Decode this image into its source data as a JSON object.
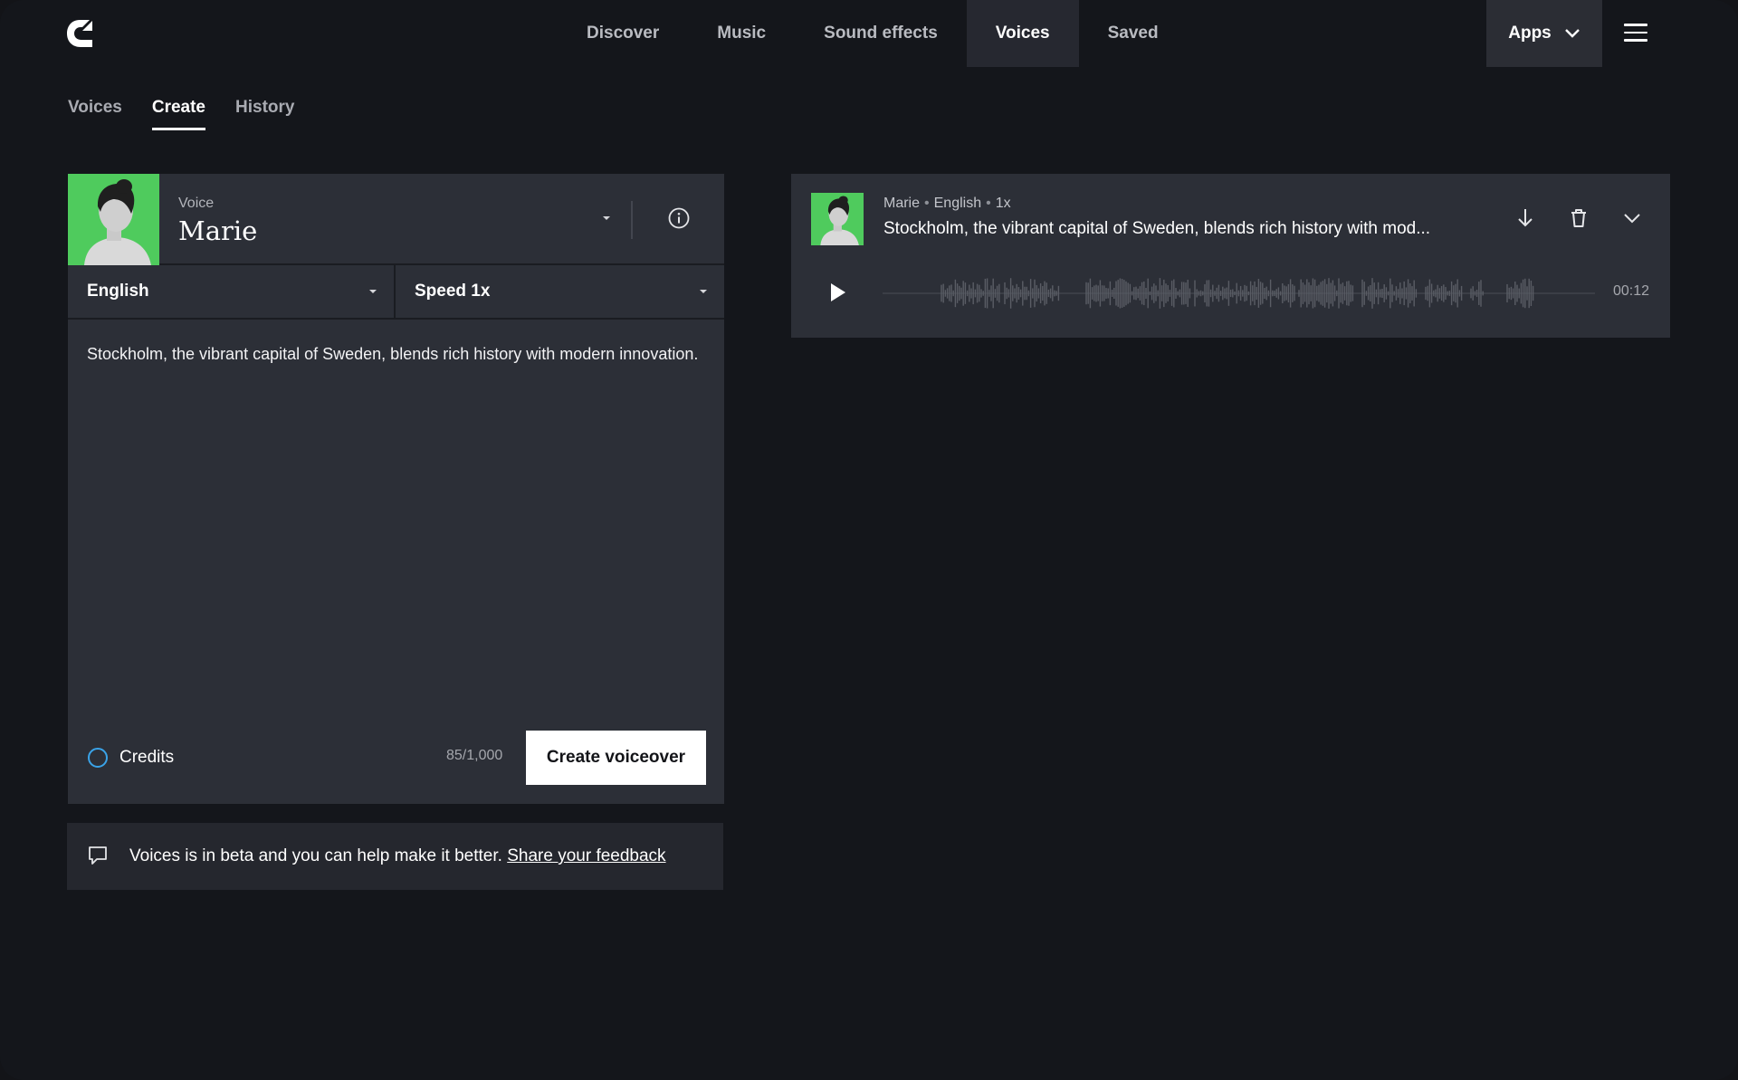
{
  "nav": {
    "links": [
      {
        "label": "Discover"
      },
      {
        "label": "Music"
      },
      {
        "label": "Sound effects"
      },
      {
        "label": "Voices"
      },
      {
        "label": "Saved"
      }
    ],
    "active_index": 3,
    "apps_label": "Apps"
  },
  "subtabs": [
    {
      "label": "Voices"
    },
    {
      "label": "Create"
    },
    {
      "label": "History"
    }
  ],
  "subtabs_active_index": 1,
  "editor": {
    "voice_caption": "Voice",
    "voice_name": "Marie",
    "language": "English",
    "speed": "Speed 1x",
    "text": "Stockholm, the vibrant capital of Sweden, blends rich history with modern innovation.",
    "credits_label": "Credits",
    "counter": "85/1,000",
    "create_label": "Create voiceover"
  },
  "beta": {
    "text": "Voices is in beta and you can help make it better.",
    "link": "Share your feedback"
  },
  "result": {
    "meta_voice": "Marie",
    "meta_language": "English",
    "meta_speed": "1x",
    "title": "Stockholm, the vibrant capital of Sweden, blends rich history with mod...",
    "duration": "00:12"
  },
  "icons": {
    "logo": "brand-logo-icon",
    "apps_chevron": "chevron-down-icon",
    "menu": "hamburger-menu-icon",
    "voice_caret": "caret-down-icon",
    "info": "info-icon",
    "credits": "credits-ring-icon",
    "beta": "chat-bubble-icon",
    "download": "download-icon",
    "delete": "trash-icon",
    "expand": "chevron-down-icon",
    "play": "play-icon"
  },
  "colors": {
    "background": "#14161b",
    "panel": "#2c2f37",
    "avatar_bg": "#4fcb5d",
    "credit_ring": "#3aa3e8",
    "primary_button": "#ffffff"
  }
}
